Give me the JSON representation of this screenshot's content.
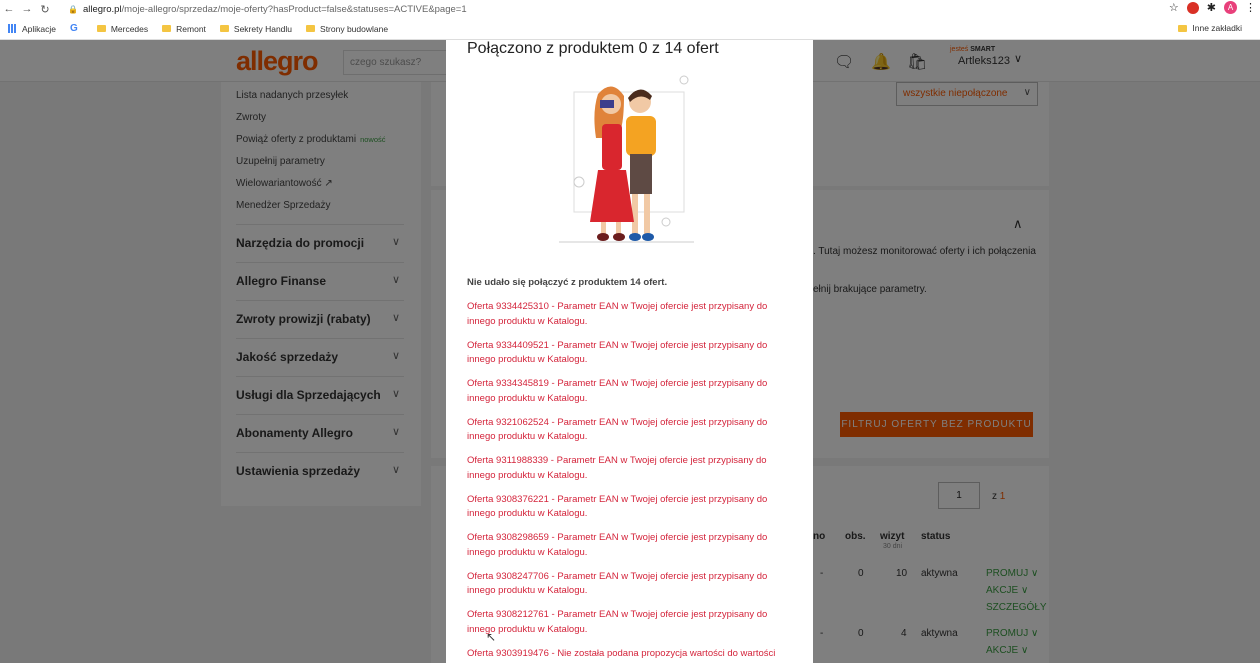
{
  "browser": {
    "url_host": "allegro.pl",
    "url_path": "/moje-allegro/sprzedaz/moje-oferty?hasProduct=false&statuses=ACTIVE&page=1",
    "bookmarks": [
      "Aplikacje",
      "Mercedes",
      "Remont",
      "Sekrety Handlu",
      "Strony budowlane"
    ],
    "other_bookmarks": "Inne zakładki",
    "avatar_letter": "A"
  },
  "header": {
    "logo": "allegro",
    "search_placeholder": "czego szukasz?",
    "smart_prefix": "jesteś",
    "smart_label": "SMART",
    "username": "Artleks123"
  },
  "sidebar": {
    "links": [
      "Lista nadanych przesyłek",
      "Zwroty",
      "Powiąż oferty z produktami",
      "Uzupełnij parametry",
      "Wielowariantowość",
      "Menedżer Sprzedaży"
    ],
    "new_badge": "nowość",
    "sections": [
      "Narzędzia do promocji",
      "Allegro Finanse",
      "Zwroty prowizji (rabaty)",
      "Jakość sprzedaży",
      "Usługi dla Sprzedających",
      "Abonamenty Allegro",
      "Ustawienia sprzedaży"
    ]
  },
  "main": {
    "filter_select": "wszystkie niepołączone",
    "info_text_1": ". Tutaj możesz monitorować oferty i ich połączenia",
    "info_text_2": "ełnij brakujące parametry.",
    "filter_button": "FILTRUJ OFERTY BEZ PRODUKTU",
    "page_value": "1",
    "page_of": "z",
    "page_total": "1",
    "columns": {
      "partial": "no",
      "partial_sub": "dni",
      "obs": "obs.",
      "wizyt": "wizyt",
      "wizyt_sub": "30 dni",
      "status": "status"
    },
    "rows": [
      {
        "dash": "-",
        "obs": "0",
        "wizyt": "10",
        "status": "aktywna",
        "promo": "PROMUJ",
        "akcje": "AKCJE",
        "details": "SZCZEGÓŁY"
      },
      {
        "dash": "-",
        "obs": "0",
        "wizyt": "4",
        "status": "aktywna",
        "promo": "PROMUJ",
        "akcje": "AKCJE"
      }
    ]
  },
  "modal": {
    "title": "Połączono z produktem 0 z 14 ofert",
    "fail_heading": "Nie udało się połączyć z produktem 14 ofert.",
    "offers": [
      "Oferta 9334425310 - Parametr EAN w Twojej ofercie jest przypisany do innego produktu w Katalogu.",
      "Oferta 9334409521 - Parametr EAN w Twojej ofercie jest przypisany do innego produktu w Katalogu.",
      "Oferta 9334345819 - Parametr EAN w Twojej ofercie jest przypisany do innego produktu w Katalogu.",
      "Oferta 9321062524 - Parametr EAN w Twojej ofercie jest przypisany do innego produktu w Katalogu.",
      "Oferta 9311988339 - Parametr EAN w Twojej ofercie jest przypisany do innego produktu w Katalogu.",
      "Oferta 9308376221 - Parametr EAN w Twojej ofercie jest przypisany do innego produktu w Katalogu.",
      "Oferta 9308298659 - Parametr EAN w Twojej ofercie jest przypisany do innego produktu w Katalogu.",
      "Oferta 9308247706 - Parametr EAN w Twojej ofercie jest przypisany do innego produktu w Katalogu.",
      "Oferta 9308212761 - Parametr EAN w Twojej ofercie jest przypisany do innego produktu w Katalogu.",
      "Oferta 9303919476 - Nie została podana propozycja wartości do wartości"
    ]
  },
  "colors": {
    "accent": "#ff5a00",
    "error": "#d4243b",
    "green": "#3b9e43"
  }
}
